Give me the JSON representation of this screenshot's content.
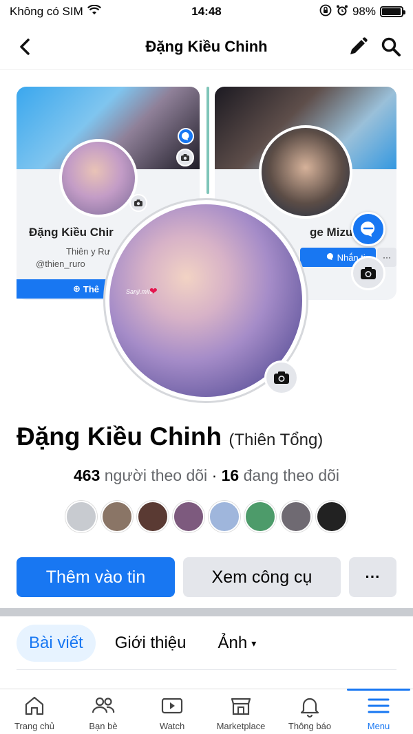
{
  "status_bar": {
    "carrier": "Không có SIM",
    "time": "14:48",
    "battery_pct": "98%",
    "battery_level": 0.98
  },
  "header": {
    "title": "Đặng Kiều Chinh"
  },
  "cover": {
    "left_name": "Đặng Kiều Chir",
    "left_sub1": "Thiên y Rư",
    "left_handle": "@thien_ruro",
    "left_btn": "Thê",
    "right_name": "ge Mizu",
    "right_btn": "Nhắn tin",
    "right_more": "···",
    "avatar_tag": "Sanji.mini"
  },
  "profile": {
    "name": "Đặng Kiều Chinh",
    "alt_name": "(Thiên Tổng)",
    "followers_count": "463",
    "followers_label": "người theo dõi",
    "stat_separator": "·",
    "following_count": "16",
    "following_label": "đang theo dõi"
  },
  "friends": [
    {
      "color": "#c8cbd0"
    },
    {
      "color": "#8a7566"
    },
    {
      "color": "#5a3a33"
    },
    {
      "color": "#7d5a7e"
    },
    {
      "color": "#9fb6dc"
    },
    {
      "color": "#4d9b6a"
    },
    {
      "color": "#6f6a72"
    },
    {
      "color": "#222222"
    }
  ],
  "actions": {
    "primary": "Thêm vào tin",
    "secondary": "Xem công cụ",
    "more": "···"
  },
  "tabs": {
    "posts": "Bài viết",
    "about": "Giới thiệu",
    "photos": "Ảnh",
    "caret": "▾"
  },
  "bottom_nav": {
    "home": "Trang chủ",
    "friends": "Bạn bè",
    "watch": "Watch",
    "marketplace": "Marketplace",
    "notifications": "Thông báo",
    "menu": "Menu"
  },
  "colors": {
    "accent": "#1877f2",
    "secondary_bg": "#e4e6eb"
  }
}
